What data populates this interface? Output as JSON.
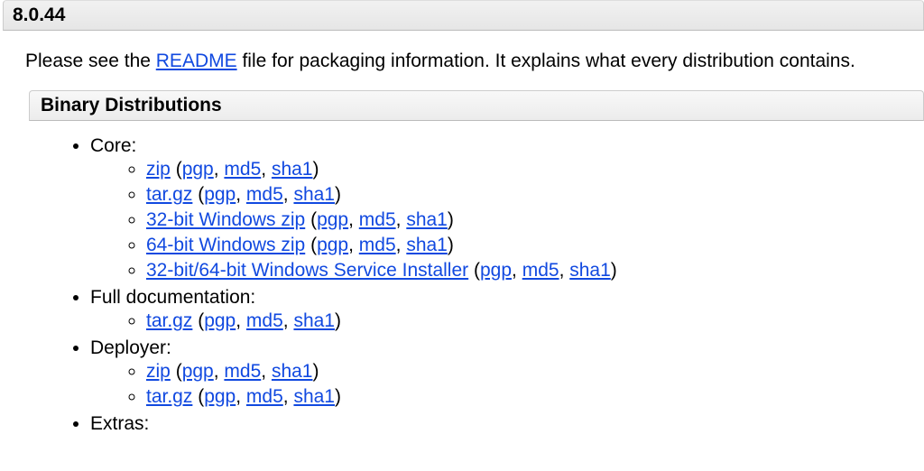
{
  "version": "8.0.44",
  "intro": {
    "prefix": "Please see the ",
    "readme_link": "README",
    "suffix": " file for packaging information. It explains what every distribution contains."
  },
  "section_title": "Binary Distributions",
  "sig": {
    "pgp": "pgp",
    "md5": "md5",
    "sha1": "sha1"
  },
  "groups": [
    {
      "label": "Core:",
      "items": [
        {
          "name": "zip"
        },
        {
          "name": "tar.gz"
        },
        {
          "name": "32-bit Windows zip"
        },
        {
          "name": "64-bit Windows zip"
        },
        {
          "name": "32-bit/64-bit Windows Service Installer"
        }
      ]
    },
    {
      "label": "Full documentation:",
      "items": [
        {
          "name": "tar.gz"
        }
      ]
    },
    {
      "label": "Deployer:",
      "items": [
        {
          "name": "zip"
        },
        {
          "name": "tar.gz"
        }
      ]
    },
    {
      "label": "Extras:",
      "items": []
    }
  ]
}
